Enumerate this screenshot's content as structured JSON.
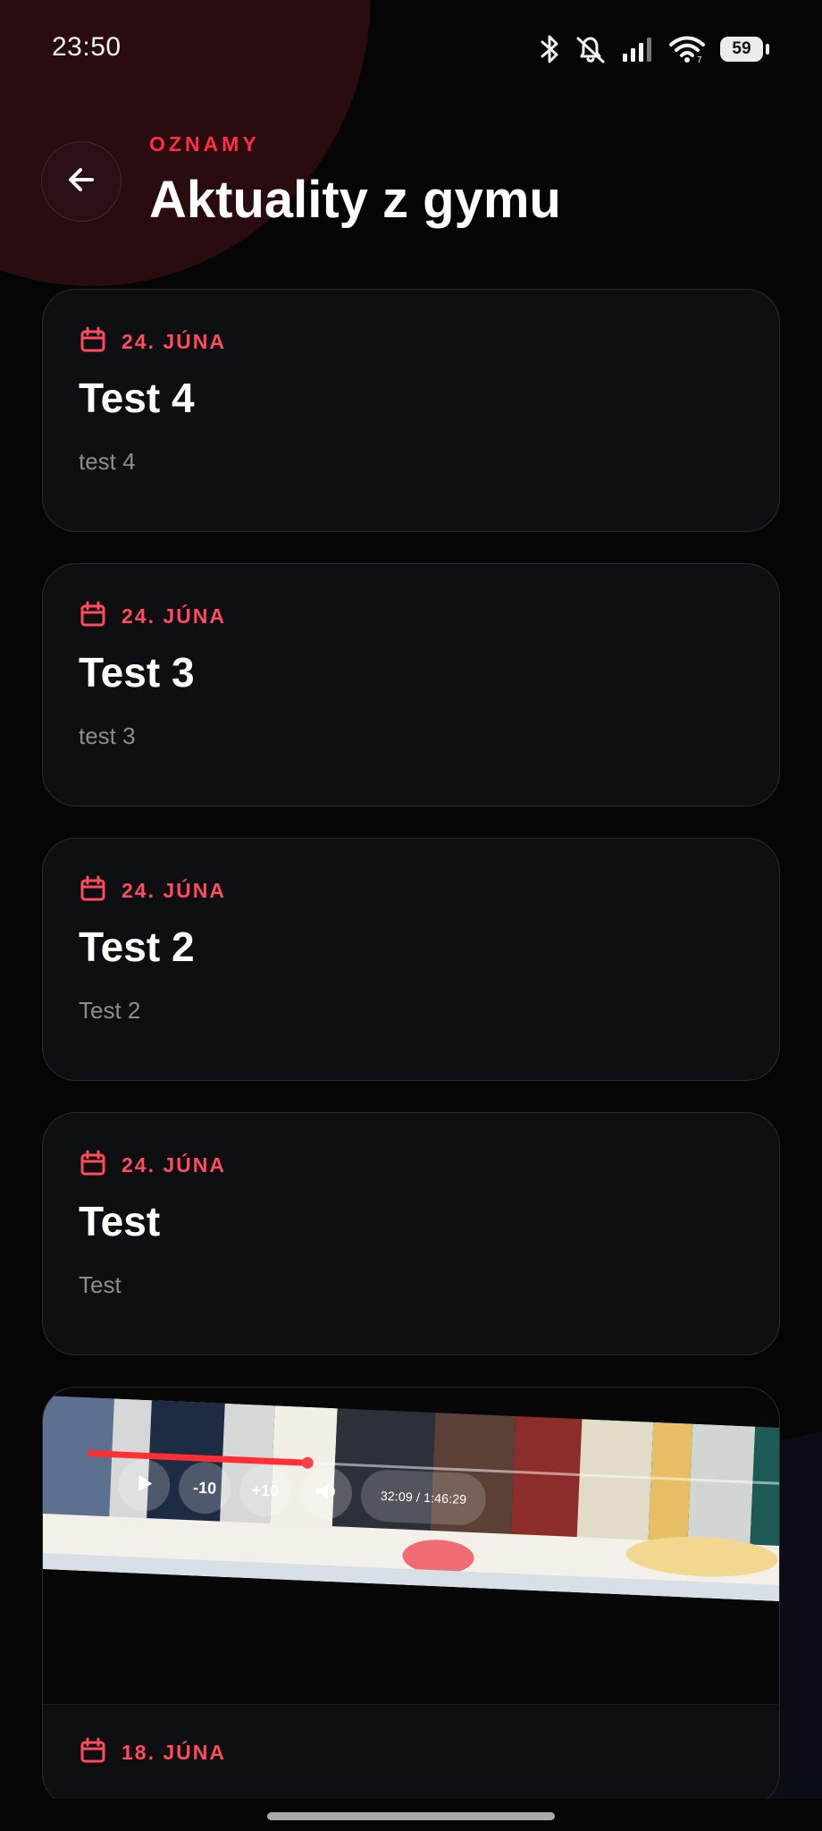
{
  "status_bar": {
    "time": "23:50",
    "battery": "59",
    "icons": [
      "bluetooth-icon",
      "mute-icon",
      "signal-icon",
      "wifi-icon",
      "battery-icon"
    ]
  },
  "header": {
    "eyebrow": "OZNAMY",
    "title": "Aktuality z gymu",
    "back_icon": "arrow-left-icon"
  },
  "announcements": [
    {
      "date": "24. JÚNA",
      "title": "Test 4",
      "body": "test 4"
    },
    {
      "date": "24. JÚNA",
      "title": "Test 3",
      "body": "test 3"
    },
    {
      "date": "24. JÚNA",
      "title": "Test 2",
      "body": "Test 2"
    },
    {
      "date": "24. JÚNA",
      "title": "Test",
      "body": "Test"
    }
  ],
  "media_announcement": {
    "date": "18. JÚNA",
    "video": {
      "play_icon": "play-icon",
      "rewind_label": "-10",
      "forward_label": "+10",
      "volume_icon": "volume-icon",
      "time": "32:09 / 1:46:29",
      "progress": 0.3
    }
  },
  "colors": {
    "accent": "#ff2e43",
    "background": "#050506",
    "card": "#0e0f12",
    "muted_text": "#8b8c92"
  }
}
